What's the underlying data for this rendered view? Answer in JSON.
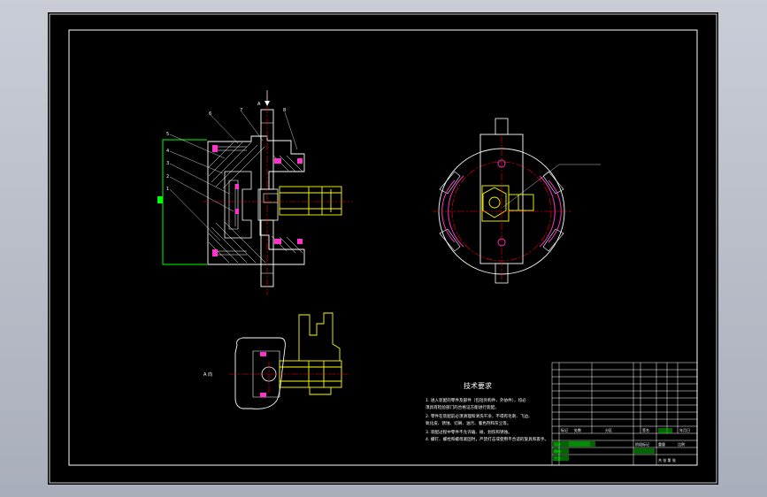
{
  "drawing": {
    "view_label_a": "A",
    "view_label_direction": "A 向",
    "part_numbers": [
      "1",
      "2",
      "3",
      "4",
      "5",
      "6",
      "7",
      "8"
    ],
    "notes_title": "技术要求",
    "notes": [
      "1. 进入装配的零件及部件（包括外购件、外协件），均必",
      "须具有检验部门的合格证方能进行装配。",
      "2. 零件在装配前必须清理和清洗干净，不得有毛刺、飞边、",
      "氧化皮、锈蚀、切屑、油污、着色剂和灰尘等。",
      "3. 装配过程中零件不允许磕、碰、划伤和锈蚀。",
      "4. 螺钉、螺栓和螺母紧固时，严禁打击或使用不合适的旋具和扳手。"
    ],
    "title_block": {
      "labels": [
        "标记",
        "处数",
        "分区",
        "更改文件号",
        "签名",
        "年月日"
      ],
      "left_cells": [
        "设计",
        "标准化",
        "审核",
        "工艺",
        "批准"
      ],
      "stage_labels": [
        "阶段标记",
        "重量",
        "比例"
      ],
      "sheet": "共 张 第 张"
    }
  }
}
